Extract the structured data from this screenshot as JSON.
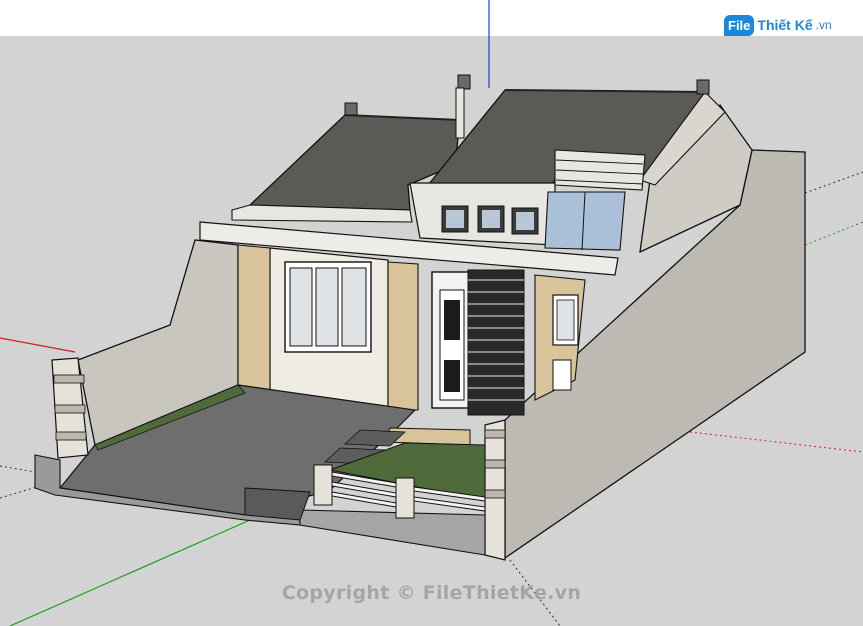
{
  "logo": {
    "badge": "File",
    "name": "Thiết Kế",
    "domain": ".vn"
  },
  "watermark": "Copyright © FileThietKe.vn",
  "colors": {
    "sky": "#ffffff",
    "ground": "#d3d3d3",
    "roof": "#5c5a56",
    "wall": "#d9d6d0",
    "stone": "#d8c39a",
    "lawn": "#4f6b3c",
    "paving": "#787878",
    "axis_red": "#d02020",
    "axis_green": "#1aa01a",
    "axis_blue": "#2040d0",
    "brand": "#1e88d8"
  }
}
